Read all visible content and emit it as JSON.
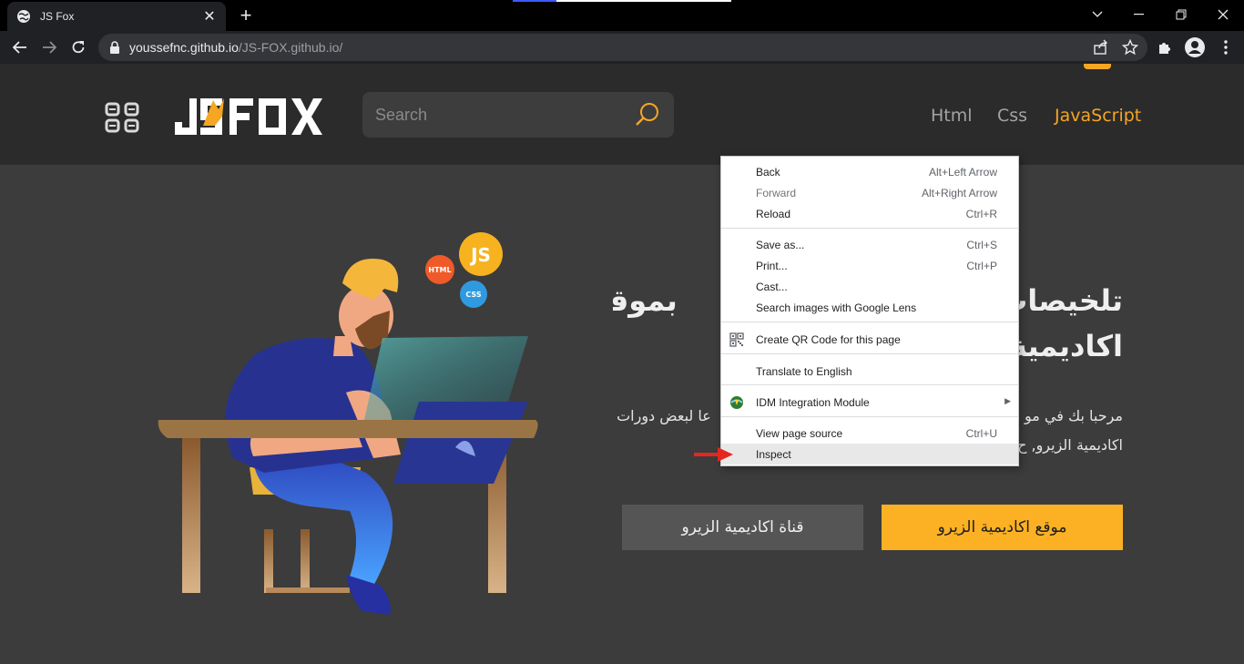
{
  "browser": {
    "tab_title": "JS Fox",
    "url_host": "youssefnc.github.io",
    "url_path": "/JS-FOX.github.io/",
    "icons": [
      "globe-icon",
      "close-icon",
      "plus-icon",
      "back-arrow-icon",
      "forward-arrow-icon",
      "reload-icon",
      "lock-icon",
      "share-icon",
      "star-icon",
      "puzzle-icon",
      "avatar-icon",
      "kebab-menu-icon",
      "chevron-down-icon",
      "minimize-icon",
      "restore-icon",
      "window-close-icon"
    ]
  },
  "site": {
    "logo_text": "JSFOX",
    "search_placeholder": "Search",
    "nav": [
      {
        "label": "Html"
      },
      {
        "label": "Css"
      },
      {
        "label": "JavaScript",
        "active": true
      }
    ],
    "accent_color": "#f5a623",
    "hero": {
      "title_line1": "تلخيصات",
      "title_line1b": "بموقع",
      "title_line2": "اكاديمية",
      "text_line1a": "مرحبا بك في مو",
      "text_line1b": "عا لبعض دورات",
      "text_line2": "اكاديمية الزيرو, ح",
      "badge_js": "JS",
      "badge_html": "HTML",
      "badge_css": "CSS"
    },
    "buttons": {
      "channel": "قناة اكاديمية الزيرو",
      "website": "موقع اكاديمية الزيرو"
    }
  },
  "context_menu": {
    "items": [
      {
        "label": "Back",
        "shortcut": "Alt+Left Arrow"
      },
      {
        "label": "Forward",
        "shortcut": "Alt+Right Arrow",
        "disabled": true
      },
      {
        "label": "Reload",
        "shortcut": "Ctrl+R"
      },
      {
        "label": "Save as...",
        "shortcut": "Ctrl+S"
      },
      {
        "label": "Print...",
        "shortcut": "Ctrl+P"
      },
      {
        "label": "Cast...",
        "shortcut": ""
      },
      {
        "label": "Search images with Google Lens",
        "shortcut": ""
      },
      {
        "label": "Create QR Code for this page",
        "shortcut": "",
        "icon": "qr-code-icon"
      },
      {
        "label": "Translate to English",
        "shortcut": ""
      },
      {
        "label": "IDM Integration Module",
        "shortcut": "",
        "icon": "idm-icon",
        "submenu": true
      },
      {
        "label": "View page source",
        "shortcut": "Ctrl+U"
      },
      {
        "label": "Inspect",
        "shortcut": "",
        "highlighted": true
      }
    ]
  }
}
